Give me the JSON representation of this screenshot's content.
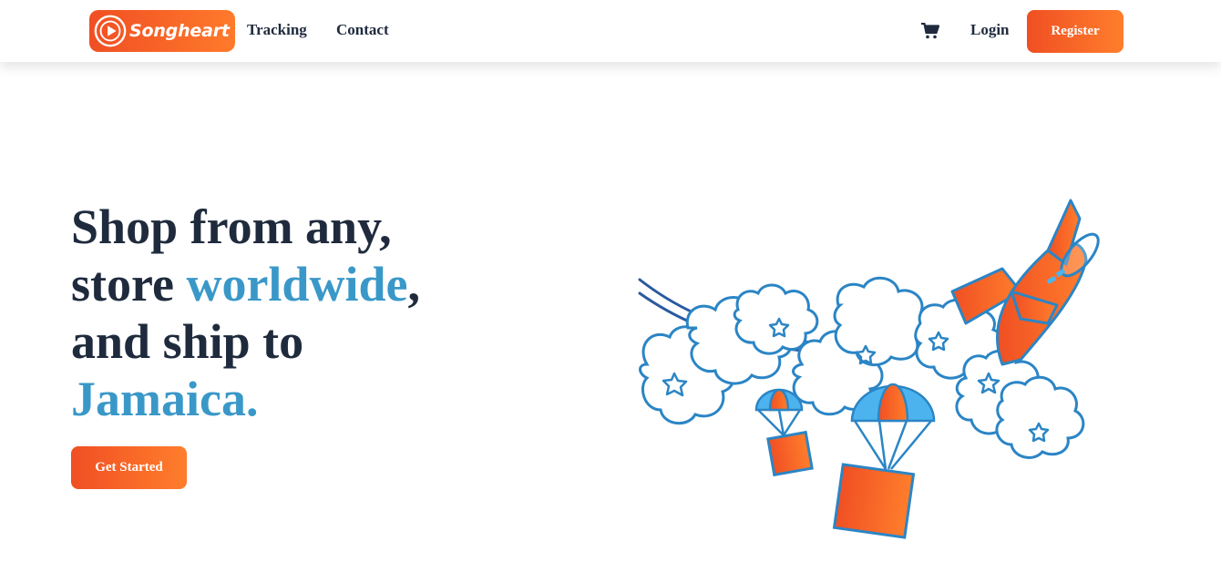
{
  "nav": {
    "logo_text": "Songheart",
    "links": [
      {
        "label": "Tracking"
      },
      {
        "label": "Contact"
      }
    ],
    "cart_icon": "shopping-cart-icon",
    "login_label": "Login",
    "register_label": "Register"
  },
  "hero": {
    "line1": "Shop from any,",
    "line2_prefix": "store ",
    "line2_accent": "worldwide",
    "line2_suffix": ",",
    "line3": "and ship to",
    "line4_accent": "Jamaica.",
    "cta_label": "Get Started"
  },
  "colors": {
    "brand_orange": "#f04f23",
    "brand_orange_light": "#ff7e2c",
    "heading_dark": "#1f2b3d",
    "accent_blue": "#3a98c8"
  }
}
